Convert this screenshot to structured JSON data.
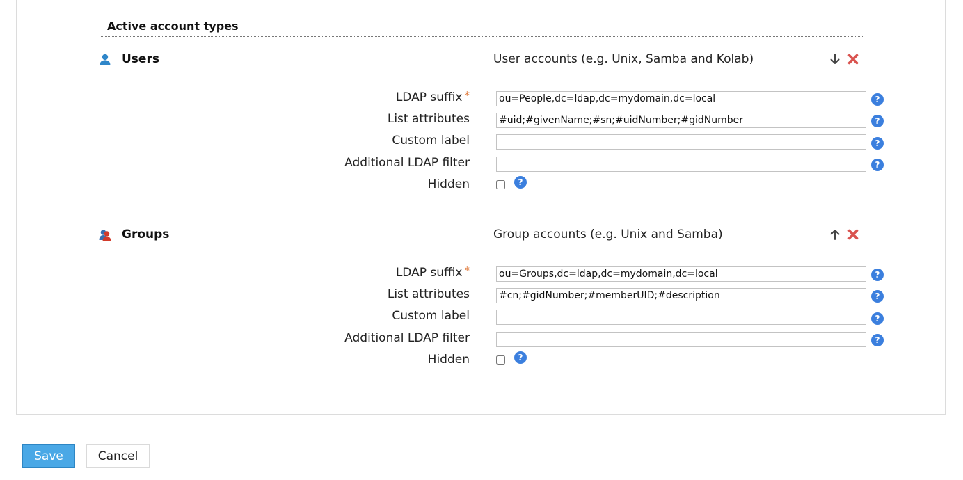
{
  "section": {
    "title": "Active account types"
  },
  "types": {
    "users": {
      "name": "Users",
      "description": "User accounts (e.g. Unix, Samba and Kolab)",
      "icon": "user-icon",
      "move_icon": "arrow-down-icon",
      "labels": {
        "ldap_suffix": "LDAP suffix",
        "list_attributes": "List attributes",
        "custom_label": "Custom label",
        "additional_filter": "Additional LDAP filter",
        "hidden": "Hidden"
      },
      "required_mark": "*",
      "values": {
        "ldap_suffix": "ou=People,dc=ldap,dc=mydomain,dc=local",
        "list_attributes": "#uid;#givenName;#sn;#uidNumber;#gidNumber",
        "custom_label": "",
        "additional_filter": ""
      },
      "hidden_checked": false
    },
    "groups": {
      "name": "Groups",
      "description": "Group accounts (e.g. Unix and Samba)",
      "icon": "group-icon",
      "move_icon": "arrow-up-icon",
      "labels": {
        "ldap_suffix": "LDAP suffix",
        "list_attributes": "List attributes",
        "custom_label": "Custom label",
        "additional_filter": "Additional LDAP filter",
        "hidden": "Hidden"
      },
      "required_mark": "*",
      "values": {
        "ldap_suffix": "ou=Groups,dc=ldap,dc=mydomain,dc=local",
        "list_attributes": "#cn;#gidNumber;#memberUID;#description",
        "custom_label": "",
        "additional_filter": ""
      },
      "hidden_checked": false
    }
  },
  "help_glyph": "?",
  "buttons": {
    "save": "Save",
    "cancel": "Cancel"
  },
  "colors": {
    "accent": "#4aa8e6",
    "help": "#3b7fde",
    "delete": "#d9534f",
    "required": "#e0793a"
  }
}
